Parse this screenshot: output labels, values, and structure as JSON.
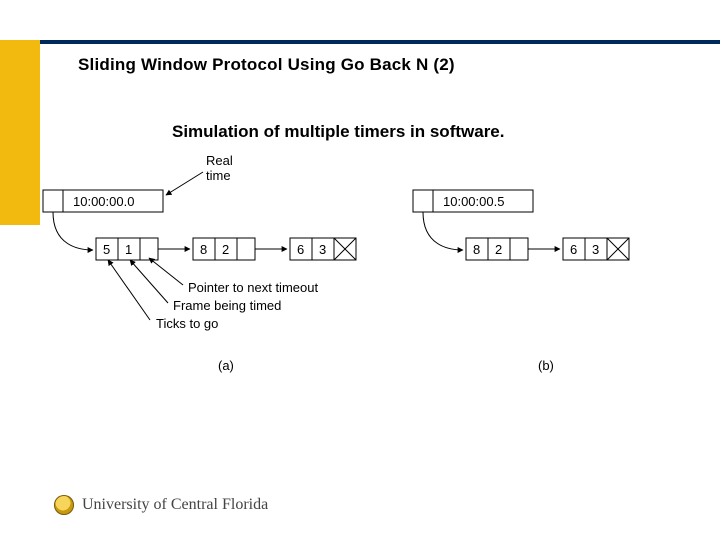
{
  "title": "Sliding Window Protocol Using Go Back N (2)",
  "subtitle": "Simulation of multiple timers in software.",
  "labels": {
    "real_time": "Real\ntime",
    "ptr": "Pointer to next timeout",
    "frame": "Frame being timed",
    "ticks": "Ticks to go",
    "a": "(a)",
    "b": "(b)"
  },
  "left": {
    "head_time": "10:00:00.0",
    "nodes": [
      {
        "ticks": "5",
        "frame": "1"
      },
      {
        "ticks": "8",
        "frame": "2"
      },
      {
        "ticks": "6",
        "frame": "3"
      }
    ]
  },
  "right": {
    "head_time": "10:00:00.5",
    "nodes": [
      {
        "ticks": "8",
        "frame": "2"
      },
      {
        "ticks": "6",
        "frame": "3"
      }
    ]
  },
  "footer": "University of Central Florida"
}
